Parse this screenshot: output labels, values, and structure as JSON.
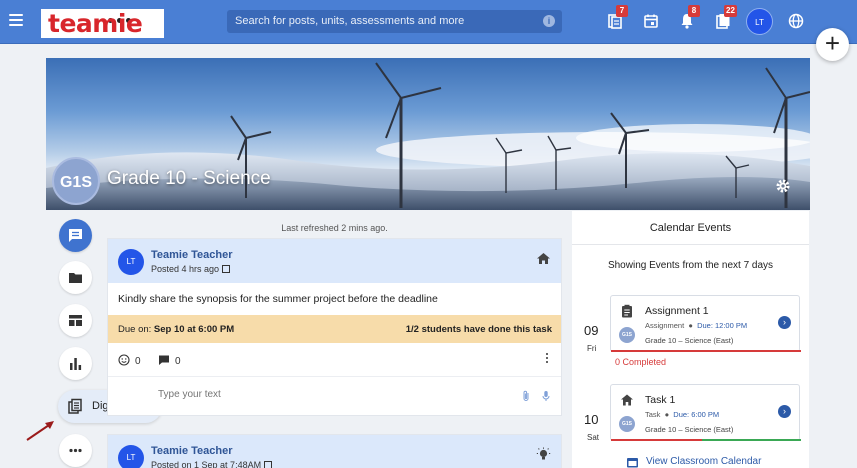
{
  "topbar": {
    "logo_text": "teamie",
    "search_placeholder": "Search for posts, units, assessments and more",
    "badges": {
      "posts": "7",
      "notifications": "8",
      "messages": "22"
    },
    "user_initials": "LT",
    "colors": {
      "bar": "#4a7fd4",
      "badge": "#d63a3a"
    }
  },
  "course": {
    "avatar_text": "G1S",
    "title": "Grade 10 - Science"
  },
  "rail": {
    "tooltip_label": "Digital skills"
  },
  "feed": {
    "refresh_text": "Last refreshed 2 mins ago.",
    "post1": {
      "initials": "LT",
      "author": "Teamie Teacher",
      "time": "Posted 4 hrs ago",
      "body": "Kindly share the synopsis for the summer project before the deadline",
      "due_label": "Due on:",
      "due_value": "Sep 10 at 6:00 PM",
      "progress": "1/2 students have done this task",
      "reactions": "0",
      "comments": "0",
      "comment_placeholder": "Type your text"
    },
    "post2": {
      "initials": "LT",
      "author": "Teamie Teacher",
      "time": "Posted on 1 Sep at 7:48AM"
    }
  },
  "calendar": {
    "title": "Calendar Events",
    "subtitle": "Showing Events from the next 7 days",
    "events": [
      {
        "date_num": "09",
        "date_day": "Fri",
        "title": "Assignment 1",
        "type": "Assignment",
        "due": "Due: 12:00 PM",
        "group_avatar": "G1S",
        "group": "Grade 10 – Science (East)",
        "status": "0 Completed"
      },
      {
        "date_num": "10",
        "date_day": "Sat",
        "title": "Task 1",
        "type": "Task",
        "due": "Due: 6:00 PM",
        "group_avatar": "G1S",
        "group": "Grade 10 – Science (East)"
      }
    ],
    "link": "View Classroom Calendar"
  }
}
